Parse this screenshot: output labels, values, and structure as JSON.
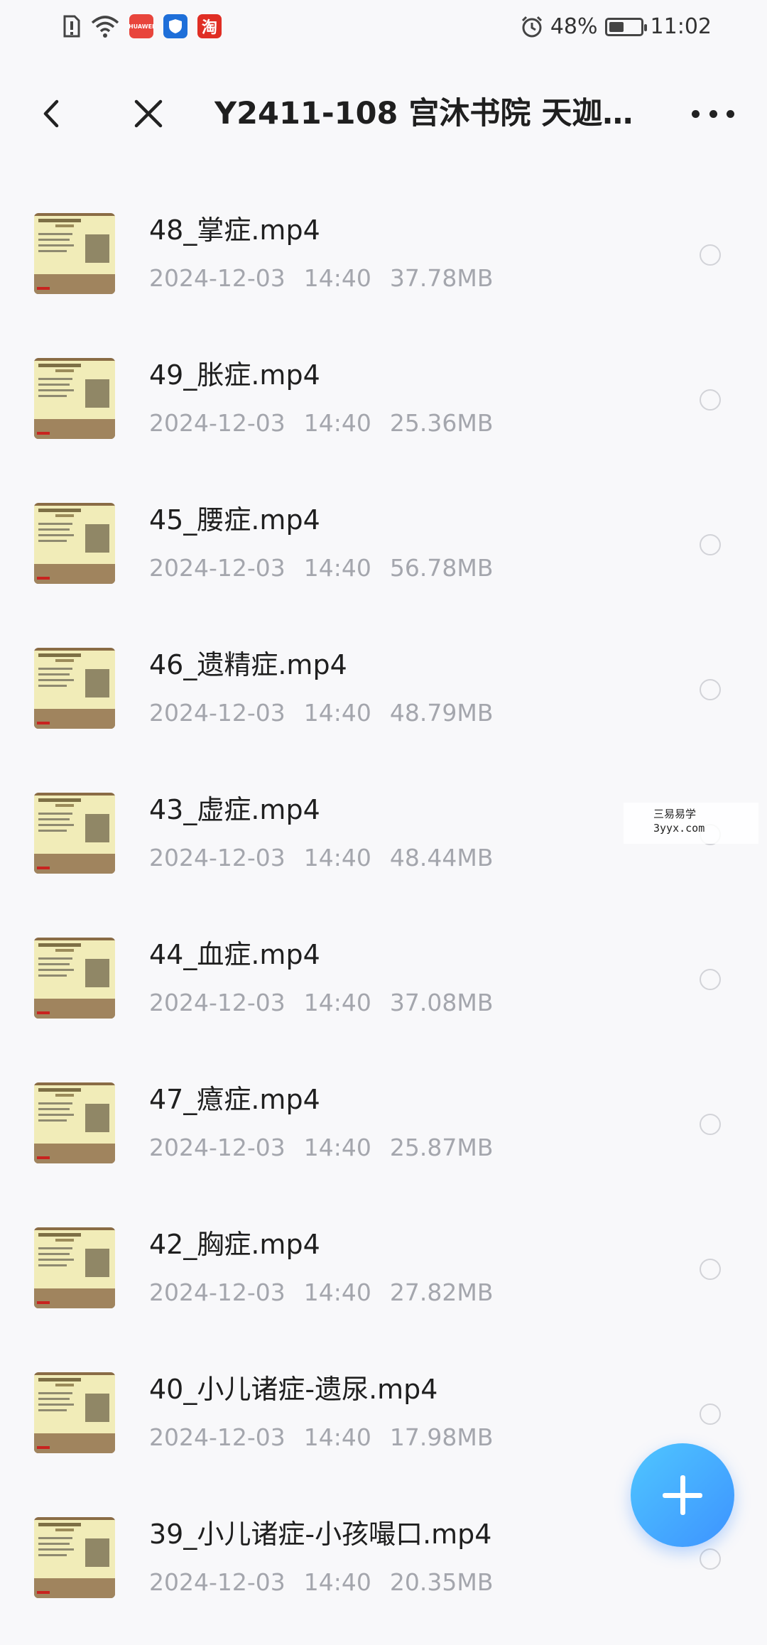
{
  "status_bar": {
    "app_icons": [
      {
        "icon": "sim-alert-icon",
        "color": "#444444"
      },
      {
        "icon": "wifi-icon",
        "color": "#444444"
      },
      {
        "icon": "vmall-app-icon",
        "color": "#e8453c",
        "text": "HUAWEI"
      },
      {
        "icon": "shield-app-icon",
        "color": "#1e6fd9"
      },
      {
        "icon": "taobao-app-icon",
        "color": "#e02e24",
        "text": "淘"
      }
    ],
    "alarm_icon": "alarm-clock-icon",
    "battery_percent": "48%",
    "battery_level": 0.48,
    "time": "11:02"
  },
  "header": {
    "title": "Y2411-108 宫沐书院 天迦…",
    "back_icon": "chevron-left-icon",
    "close_icon": "close-icon",
    "more_icon": "more-horizontal-icon"
  },
  "files": [
    {
      "name": "48_掌症.mp4",
      "date": "2024-12-03",
      "time": "14:40",
      "size": "37.78MB"
    },
    {
      "name": "49_胀症.mp4",
      "date": "2024-12-03",
      "time": "14:40",
      "size": "25.36MB"
    },
    {
      "name": "45_腰症.mp4",
      "date": "2024-12-03",
      "time": "14:40",
      "size": "56.78MB"
    },
    {
      "name": "46_遗精症.mp4",
      "date": "2024-12-03",
      "time": "14:40",
      "size": "48.79MB"
    },
    {
      "name": "43_虚症.mp4",
      "date": "2024-12-03",
      "time": "14:40",
      "size": "48.44MB"
    },
    {
      "name": "44_血症.mp4",
      "date": "2024-12-03",
      "time": "14:40",
      "size": "37.08MB"
    },
    {
      "name": "47_癔症.mp4",
      "date": "2024-12-03",
      "time": "14:40",
      "size": "25.87MB"
    },
    {
      "name": "42_胸症.mp4",
      "date": "2024-12-03",
      "time": "14:40",
      "size": "27.82MB"
    },
    {
      "name": "40_小儿诸症-遗尿.mp4",
      "date": "2024-12-03",
      "time": "14:40",
      "size": "17.98MB"
    },
    {
      "name": "39_小儿诸症-小孩嘬口.mp4",
      "date": "2024-12-03",
      "time": "14:40",
      "size": "20.35MB"
    }
  ],
  "watermark": {
    "line1": "三易易学",
    "line2": "3yyx.com"
  },
  "fab": {
    "icon": "plus-icon"
  }
}
